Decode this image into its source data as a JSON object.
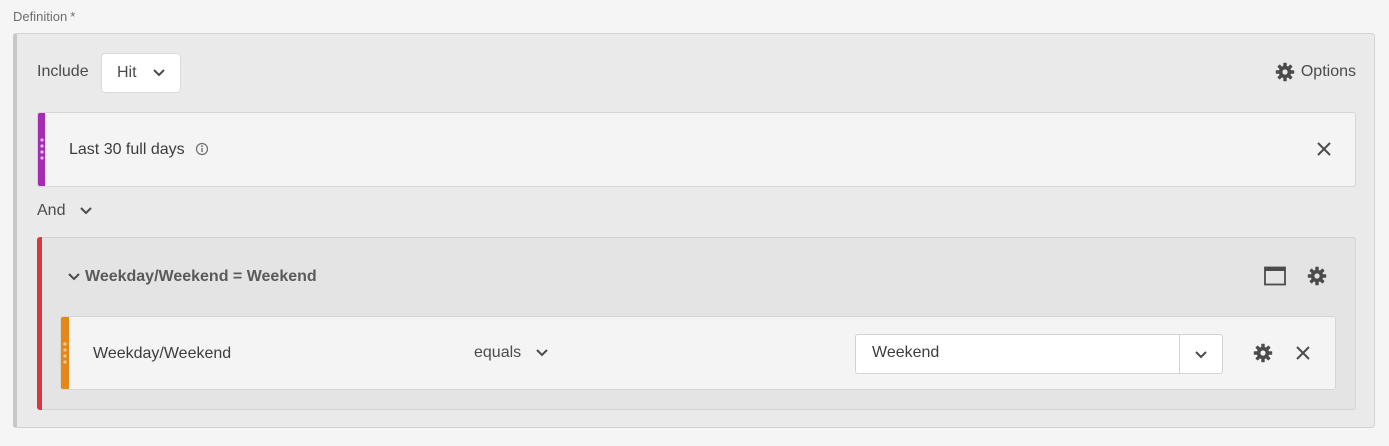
{
  "definition": {
    "label": "Definition",
    "required_mark": "*"
  },
  "header": {
    "include_label": "Include",
    "scope_value": "Hit",
    "options_label": "Options"
  },
  "rules": [
    {
      "label": "Last 30 full days",
      "color": "#a42bb3"
    }
  ],
  "logic": {
    "operator": "And"
  },
  "container": {
    "title": "Weekday/Weekend = Weekend",
    "color": "#d7373f",
    "rule": {
      "dimension": "Weekday/Weekend",
      "operator": "equals",
      "value": "Weekend",
      "color": "#e68619"
    }
  },
  "icons": [
    "gear-icon",
    "info-icon",
    "close-icon",
    "chevron-down-icon",
    "grip-icon",
    "frame-icon"
  ]
}
